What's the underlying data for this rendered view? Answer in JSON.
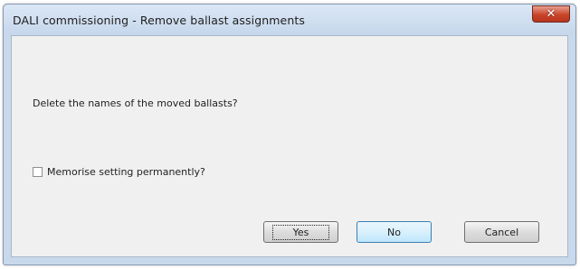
{
  "window": {
    "title": "DALI commissioning - Remove ballast assignments"
  },
  "dialog": {
    "question": "Delete the names of the moved ballasts?",
    "memorise_label": "Memorise setting permanently?",
    "memorise_checked": false
  },
  "buttons": {
    "yes": "Yes",
    "no": "No",
    "cancel": "Cancel"
  },
  "icons": {
    "close": "close-icon"
  }
}
